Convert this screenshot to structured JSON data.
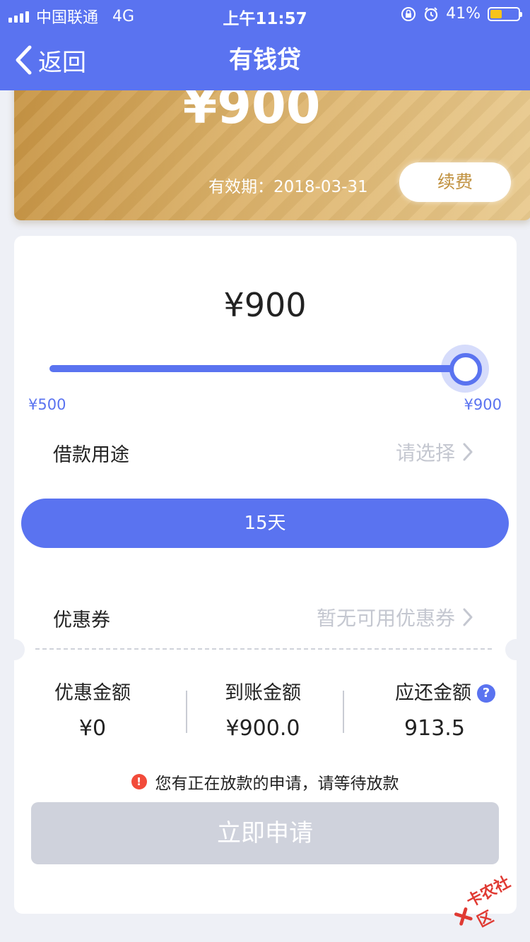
{
  "status_bar": {
    "carrier": "中国联通",
    "network": "4G",
    "time": "上午11:57",
    "battery_percent": "41%",
    "battery_level": 0.41
  },
  "nav": {
    "back_label": "返回",
    "title": "有钱贷"
  },
  "card": {
    "amount": "¥900",
    "expiry": "有效期：2018-03-31",
    "renew_label": "续费"
  },
  "loan": {
    "amount": "¥900",
    "slider": {
      "min_label": "¥500",
      "max_label": "¥900",
      "min": 500,
      "max": 900,
      "value": 900
    },
    "purpose_label": "借款用途",
    "purpose_value": "请选择",
    "term_label": "15天",
    "coupon_label": "优惠券",
    "coupon_value": "暂无可用优惠券"
  },
  "summary": {
    "discount_label": "优惠金额",
    "discount_value": "¥0",
    "received_label": "到账金额",
    "received_value": "¥900.0",
    "repay_label": "应还金额",
    "repay_value": "913.5"
  },
  "notice": "您有正在放款的申请，请等待放款",
  "apply_label": "立即申请",
  "watermark": "卡农社区",
  "colors": {
    "primary": "#5a73f0",
    "gold": "#dcb26a",
    "disabled": "#cfd2dc",
    "warning": "#f24b3a"
  }
}
